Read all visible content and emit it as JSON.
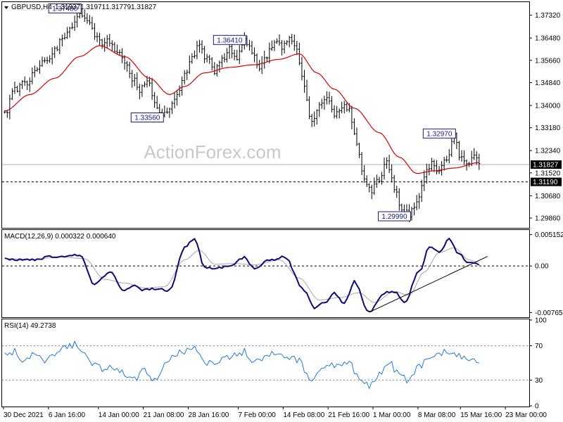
{
  "chart_data": {
    "type": "line",
    "instrument": "GBPUSD,H4",
    "ohlc": [
      "1.31937",
      "1.31971",
      "1.31779",
      "1.31827"
    ],
    "watermark": "ActionForex.com",
    "price": {
      "ylim": [
        1.2955,
        1.3775
      ],
      "yticks": [
        "1.37320",
        "1.36480",
        "1.35660",
        "1.34840",
        "1.34000",
        "1.33180",
        "1.32340",
        "1.31520",
        "1.30680",
        "1.29860"
      ],
      "current_price": 1.31827,
      "current_label": "1.31827",
      "support_level": 1.3119,
      "support_label": "1.31190",
      "anchors": [
        [
          0,
          1.337
        ],
        [
          4,
          1.346
        ],
        [
          8,
          1.348
        ],
        [
          12,
          1.352
        ],
        [
          16,
          1.356
        ],
        [
          20,
          1.36
        ],
        [
          24,
          1.366
        ],
        [
          27,
          1.37
        ],
        [
          30,
          1.3748
        ],
        [
          33,
          1.372
        ],
        [
          36,
          1.366
        ],
        [
          39,
          1.362
        ],
        [
          42,
          1.364
        ],
        [
          45,
          1.36
        ],
        [
          48,
          1.356
        ],
        [
          51,
          1.35
        ],
        [
          54,
          1.346
        ],
        [
          57,
          1.35
        ],
        [
          60,
          1.342
        ],
        [
          63,
          1.3356
        ],
        [
          66,
          1.339
        ],
        [
          69,
          1.345
        ],
        [
          72,
          1.351
        ],
        [
          75,
          1.358
        ],
        [
          78,
          1.362
        ],
        [
          81,
          1.357
        ],
        [
          84,
          1.353
        ],
        [
          87,
          1.357
        ],
        [
          90,
          1.361
        ],
        [
          93,
          1.358
        ],
        [
          96,
          1.3641
        ],
        [
          99,
          1.36
        ],
        [
          102,
          1.354
        ],
        [
          105,
          1.358
        ],
        [
          108,
          1.364
        ],
        [
          111,
          1.362
        ],
        [
          114,
          1.364
        ],
        [
          117,
          1.36
        ],
        [
          120,
          1.346
        ],
        [
          123,
          1.334
        ],
        [
          126,
          1.34
        ],
        [
          129,
          1.342
        ],
        [
          132,
          1.336
        ],
        [
          135,
          1.34
        ],
        [
          138,
          1.338
        ],
        [
          141,
          1.326
        ],
        [
          144,
          1.313
        ],
        [
          147,
          1.309
        ],
        [
          150,
          1.313
        ],
        [
          153,
          1.319
        ],
        [
          156,
          1.31
        ],
        [
          159,
          1.302
        ],
        [
          162,
          1.2999
        ],
        [
          165,
          1.305
        ],
        [
          168,
          1.314
        ],
        [
          171,
          1.319
        ],
        [
          174,
          1.316
        ],
        [
          177,
          1.32
        ],
        [
          180,
          1.3297
        ],
        [
          182,
          1.322
        ],
        [
          185,
          1.318
        ],
        [
          188,
          1.321
        ],
        [
          190,
          1.31827
        ]
      ],
      "ma_anchors": [
        [
          0,
          1.338
        ],
        [
          10,
          1.344
        ],
        [
          20,
          1.35
        ],
        [
          30,
          1.358
        ],
        [
          38,
          1.362
        ],
        [
          48,
          1.358
        ],
        [
          58,
          1.35
        ],
        [
          66,
          1.344
        ],
        [
          72,
          1.347
        ],
        [
          80,
          1.352
        ],
        [
          90,
          1.354
        ],
        [
          100,
          1.355
        ],
        [
          110,
          1.357
        ],
        [
          118,
          1.359
        ],
        [
          125,
          1.352
        ],
        [
          132,
          1.346
        ],
        [
          140,
          1.339
        ],
        [
          150,
          1.33
        ],
        [
          158,
          1.321
        ],
        [
          165,
          1.315
        ],
        [
          172,
          1.316
        ],
        [
          180,
          1.317
        ],
        [
          190,
          1.319
        ]
      ],
      "callouts": [
        {
          "label": "1.37480",
          "bar": 30,
          "value": 1.3748,
          "pos": "left"
        },
        {
          "label": "1.33560",
          "bar": 63,
          "value": 1.3356,
          "pos": "left"
        },
        {
          "label": "1.36410",
          "bar": 96,
          "value": 1.3641,
          "pos": "left"
        },
        {
          "label": "1.32970",
          "bar": 180,
          "value": 1.3297,
          "pos": "left"
        },
        {
          "label": "1.29990",
          "bar": 162,
          "value": 1.2999,
          "pos": "left"
        }
      ]
    },
    "macd": {
      "title": "MACD(12,26,9) 0.000322 0.000640",
      "ylim": [
        -0.0083,
        0.0058
      ],
      "yticks": [
        "0.005152",
        "0.00",
        "-0.00765"
      ],
      "ytick_values": [
        0.005152,
        0.0,
        -0.00765
      ],
      "anchors": [
        [
          0,
          0.0012
        ],
        [
          10,
          0.001
        ],
        [
          20,
          0.0016
        ],
        [
          30,
          0.0018
        ],
        [
          36,
          -0.003
        ],
        [
          42,
          -0.001
        ],
        [
          48,
          -0.004
        ],
        [
          52,
          -0.003
        ],
        [
          55,
          -0.004
        ],
        [
          60,
          -0.0038
        ],
        [
          66,
          -0.004
        ],
        [
          72,
          0.003
        ],
        [
          76,
          0.0045
        ],
        [
          80,
          -0.0002
        ],
        [
          86,
          -0.0004
        ],
        [
          90,
          0.0
        ],
        [
          96,
          0.0014
        ],
        [
          100,
          -0.0004
        ],
        [
          106,
          0.001
        ],
        [
          112,
          0.0015
        ],
        [
          120,
          -0.004
        ],
        [
          124,
          -0.007
        ],
        [
          128,
          -0.006
        ],
        [
          132,
          -0.0044
        ],
        [
          136,
          -0.0062
        ],
        [
          140,
          -0.0026
        ],
        [
          146,
          -0.0076
        ],
        [
          152,
          -0.0044
        ],
        [
          156,
          -0.0042
        ],
        [
          160,
          -0.006
        ],
        [
          166,
          -0.001
        ],
        [
          170,
          0.003
        ],
        [
          174,
          0.0024
        ],
        [
          178,
          0.0044
        ],
        [
          182,
          0.002
        ],
        [
          186,
          0.0004
        ],
        [
          190,
          0.0003
        ]
      ],
      "signal_anchors": [
        [
          0,
          0.0012
        ],
        [
          12,
          0.0011
        ],
        [
          22,
          0.0015
        ],
        [
          32,
          0.0012
        ],
        [
          40,
          -0.0022
        ],
        [
          48,
          -0.0028
        ],
        [
          56,
          -0.0036
        ],
        [
          64,
          -0.0034
        ],
        [
          72,
          0.001
        ],
        [
          78,
          0.0026
        ],
        [
          84,
          0.0003
        ],
        [
          92,
          0.0004
        ],
        [
          100,
          0.0002
        ],
        [
          110,
          0.001
        ],
        [
          118,
          -0.002
        ],
        [
          126,
          -0.0056
        ],
        [
          134,
          -0.0052
        ],
        [
          142,
          -0.0044
        ],
        [
          148,
          -0.006
        ],
        [
          156,
          -0.0042
        ],
        [
          162,
          -0.0048
        ],
        [
          168,
          -0.001
        ],
        [
          174,
          0.0022
        ],
        [
          180,
          0.003
        ],
        [
          186,
          0.001
        ],
        [
          190,
          0.0006
        ]
      ],
      "trendline": [
        [
          146,
          -0.0076
        ],
        [
          190,
          0.001
        ]
      ]
    },
    "rsi": {
      "title": "RSI(14) 49.2738",
      "ylim": [
        0,
        100
      ],
      "yticks": [
        "100",
        "70",
        "30",
        "0"
      ],
      "ytick_values": [
        100,
        70,
        30,
        0
      ],
      "levels": [
        70,
        30
      ],
      "anchors": [
        [
          0,
          58
        ],
        [
          4,
          64
        ],
        [
          8,
          50
        ],
        [
          12,
          60
        ],
        [
          16,
          54
        ],
        [
          20,
          62
        ],
        [
          24,
          66
        ],
        [
          28,
          72
        ],
        [
          32,
          64
        ],
        [
          36,
          48
        ],
        [
          40,
          42
        ],
        [
          44,
          46
        ],
        [
          48,
          36
        ],
        [
          52,
          30
        ],
        [
          56,
          40
        ],
        [
          60,
          32
        ],
        [
          64,
          48
        ],
        [
          68,
          58
        ],
        [
          72,
          64
        ],
        [
          76,
          68
        ],
        [
          80,
          50
        ],
        [
          86,
          52
        ],
        [
          92,
          58
        ],
        [
          96,
          64
        ],
        [
          100,
          50
        ],
        [
          106,
          62
        ],
        [
          112,
          58
        ],
        [
          118,
          52
        ],
        [
          122,
          30
        ],
        [
          126,
          38
        ],
        [
          130,
          48
        ],
        [
          134,
          44
        ],
        [
          138,
          52
        ],
        [
          142,
          30
        ],
        [
          146,
          24
        ],
        [
          150,
          38
        ],
        [
          154,
          50
        ],
        [
          158,
          36
        ],
        [
          162,
          30
        ],
        [
          166,
          46
        ],
        [
          170,
          56
        ],
        [
          174,
          60
        ],
        [
          178,
          64
        ],
        [
          182,
          58
        ],
        [
          186,
          52
        ],
        [
          190,
          49.3
        ]
      ]
    },
    "x_tick_labels": [
      {
        "bar": 0,
        "label": "30 Dec 2021"
      },
      {
        "bar": 18,
        "label": "6 Jan 16:00"
      },
      {
        "bar": 38,
        "label": "14 Jan 00:00"
      },
      {
        "bar": 56,
        "label": "21 Jan 08:00"
      },
      {
        "bar": 74,
        "label": "28 Jan 16:00"
      },
      {
        "bar": 94,
        "label": "7 Feb 00:00"
      },
      {
        "bar": 112,
        "label": "14 Feb 08:00"
      },
      {
        "bar": 130,
        "label": "21 Feb 16:00"
      },
      {
        "bar": 148,
        "label": "1 Mar 00:00"
      },
      {
        "bar": 166,
        "label": "8 Mar 08:00"
      },
      {
        "bar": 183,
        "label": "15 Mar 16:00"
      },
      {
        "bar": 201,
        "label": "23 Mar 00:00"
      }
    ],
    "n_bars": 210,
    "colors": {
      "bars": "#000000",
      "ma": "#d40000",
      "macd": "#0a0a78",
      "signal": "#a8a8a8",
      "rsi": "#1e7ad6",
      "tag_bg": "#000000",
      "callout_border": "#1a1a80",
      "grid_dash": "#000000"
    }
  }
}
